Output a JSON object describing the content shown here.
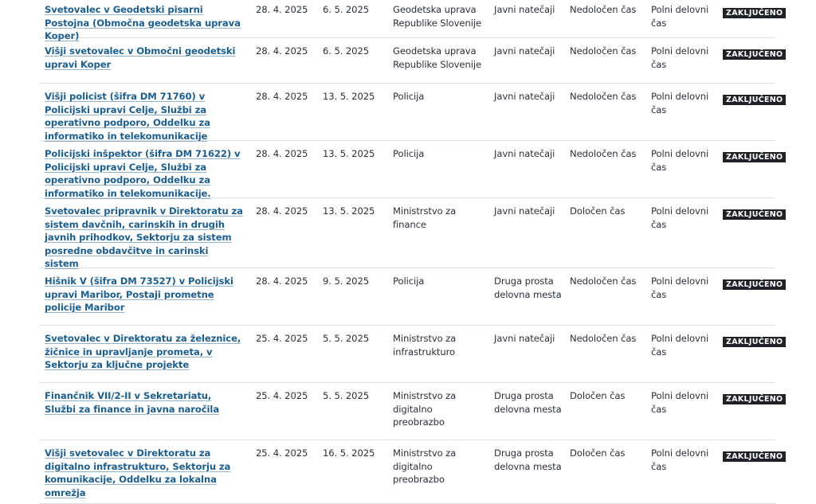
{
  "rows": [
    {
      "title": "Svetovalec v Geodetski pisarni Postojna (Območna geodetska uprava Koper)",
      "published": "28. 4. 2025",
      "deadline": "6. 5. 2025",
      "organization": "Geodetska uprava Republike Slovenije",
      "type": "Javni natečaji",
      "duration": "Nedoločen čas",
      "hours": "Polni delovni čas",
      "status": "ZAKLJUČENO"
    },
    {
      "title": "Višji svetovalec v Območni geodetski upravi Koper",
      "published": "28. 4. 2025",
      "deadline": "6. 5. 2025",
      "organization": "Geodetska uprava Republike Slovenije",
      "type": "Javni natečaji",
      "duration": "Nedoločen čas",
      "hours": "Polni delovni čas",
      "status": "ZAKLJUČENO"
    },
    {
      "title": "Višji policist (šifra DM 71760) v Policijski upravi Celje, Službi za operativno podporo, Oddelku za informatiko in telekomunikacije",
      "published": "28. 4. 2025",
      "deadline": "13. 5. 2025",
      "organization": "Policija",
      "type": "Javni natečaji",
      "duration": "Nedoločen čas",
      "hours": "Polni delovni čas",
      "status": "ZAKLJUČENO"
    },
    {
      "title": "Policijski inšpektor (šifra DM 71622) v Policijski upravi Celje, Službi za operativno podporo, Oddelku za informatiko in telekomunikacije.",
      "published": "28. 4. 2025",
      "deadline": "13. 5. 2025",
      "organization": "Policija",
      "type": "Javni natečaji",
      "duration": "Nedoločen čas",
      "hours": "Polni delovni čas",
      "status": "ZAKLJUČENO"
    },
    {
      "title": "Svetovalec pripravnik v Direktoratu za sistem davčnih, carinskih in drugih javnih prihodkov, Sektorju za sistem posredne obdavčitve in carinski sistem",
      "published": "28. 4. 2025",
      "deadline": "13. 5. 2025",
      "organization": "Ministrstvo za finance",
      "type": "Javni natečaji",
      "duration": "Določen čas",
      "hours": "Polni delovni čas",
      "status": "ZAKLJUČENO"
    },
    {
      "title": "Hišnik V (šifra DM 73527) v Policijski upravi Maribor, Postaji prometne policije Maribor",
      "published": "28. 4. 2025",
      "deadline": "9. 5. 2025",
      "organization": "Policija",
      "type": "Druga prosta delovna mesta",
      "duration": "Nedoločen čas",
      "hours": "Polni delovni čas",
      "status": "ZAKLJUČENO"
    },
    {
      "title": "Svetovalec v Direktoratu za železnice, žičnice in upravljanje prometa, v Sektorju za ključne projekte",
      "published": "25. 4. 2025",
      "deadline": "5. 5. 2025",
      "organization": "Ministrstvo za infrastrukturo",
      "type": "Javni natečaji",
      "duration": "Nedoločen čas",
      "hours": "Polni delovni čas",
      "status": "ZAKLJUČENO"
    },
    {
      "title": "Finančnik VII/2-II v Sekretariatu, Službi za finance in javna naročila",
      "published": "25. 4. 2025",
      "deadline": "5. 5. 2025",
      "organization": "Ministrstvo za digitalno preobrazbo",
      "type": "Druga prosta delovna mesta",
      "duration": "Določen čas",
      "hours": "Polni delovni čas",
      "status": "ZAKLJUČENO"
    },
    {
      "title": "Višji svetovalec v Direktoratu za digitalno infrastrukturo, Sektorju za komunikacije, Oddelku za lokalna omrežja",
      "published": "25. 4. 2025",
      "deadline": "16. 5. 2025",
      "organization": "Ministrstvo za digitalno preobrazbo",
      "type": "Druga prosta delovna mesta",
      "duration": "Določen čas",
      "hours": "Polni delovni čas",
      "status": "ZAKLJUČENO"
    }
  ]
}
